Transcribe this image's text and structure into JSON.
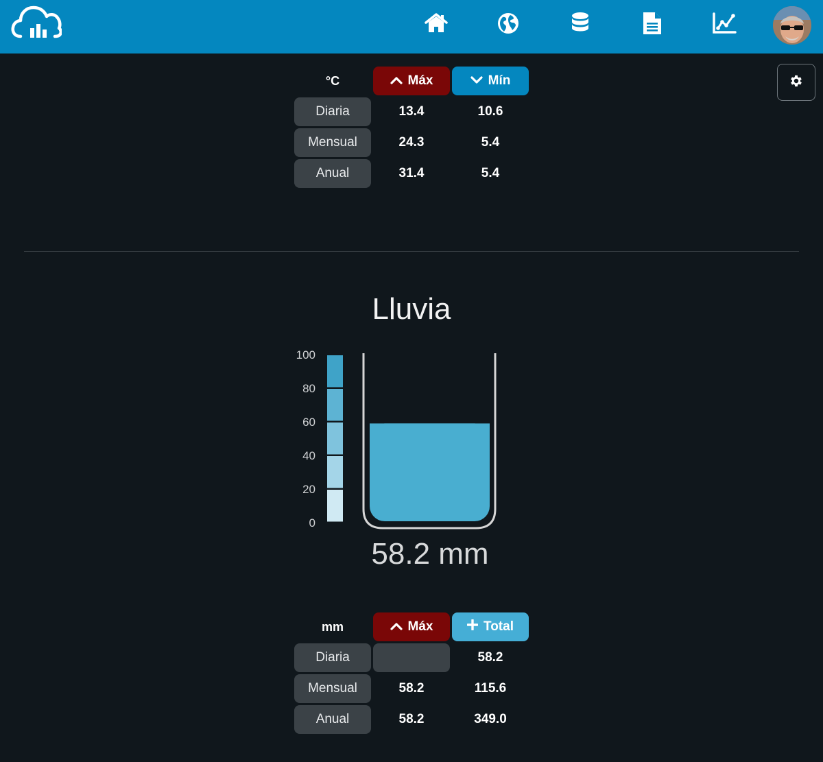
{
  "nav": {
    "icons": [
      "cloud-chart-logo-icon",
      "home-icon",
      "globe-icon",
      "database-icon",
      "document-icon",
      "line-chart-icon"
    ]
  },
  "colors": {
    "topbar": "#0487bf",
    "background": "#10171c",
    "max_pill": "#7a0707",
    "min_pill": "#0487bf",
    "total_pill": "#45aed6",
    "row_label_bg": "#3b4247",
    "water": "#49aed0"
  },
  "temperature": {
    "unit": "°C",
    "max_label": "Máx",
    "min_label": "Mín",
    "rows": [
      {
        "label": "Diaria",
        "max": "13.4",
        "min": "10.6"
      },
      {
        "label": "Mensual",
        "max": "24.3",
        "min": "5.4"
      },
      {
        "label": "Anual",
        "max": "31.4",
        "min": "5.4"
      }
    ]
  },
  "rain": {
    "title": "Lluvia",
    "scale": [
      "100",
      "80",
      "60",
      "40",
      "20",
      "0"
    ],
    "level_value": 58.2,
    "scale_max": 100,
    "reading": "58.2 mm",
    "unit": "mm",
    "max_label": "Máx",
    "total_label": "Total",
    "rows": [
      {
        "label": "Diaria",
        "max": "",
        "total": "58.2"
      },
      {
        "label": "Mensual",
        "max": "58.2",
        "total": "115.6"
      },
      {
        "label": "Anual",
        "max": "58.2",
        "total": "349.0"
      }
    ]
  }
}
